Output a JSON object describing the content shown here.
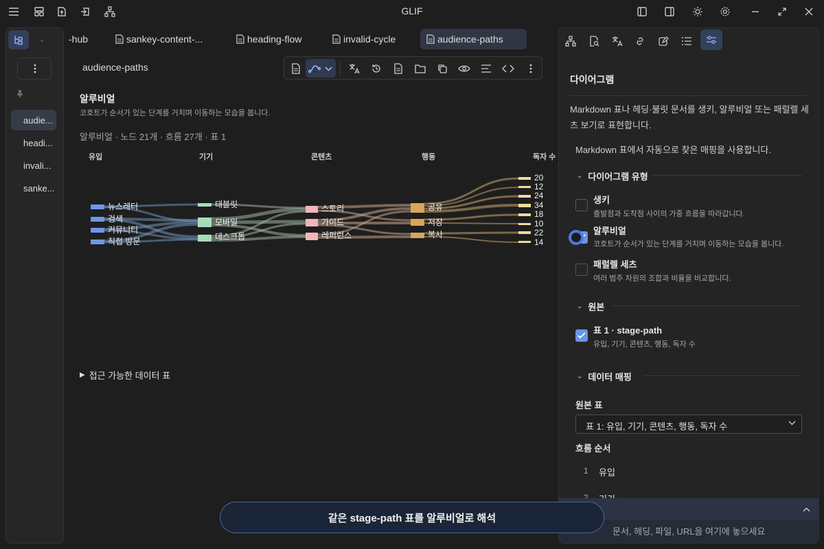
{
  "app": {
    "title": "GLIF"
  },
  "left_sidebar": {
    "files": [
      "audie...",
      "headi...",
      "invali...",
      "sanke..."
    ],
    "active_index": 0
  },
  "tabs": {
    "items": [
      {
        "label": "-hub",
        "active": false
      },
      {
        "label": "sankey-content-...",
        "active": false
      },
      {
        "label": "heading-flow",
        "active": false
      },
      {
        "label": "invalid-cycle",
        "active": false
      },
      {
        "label": "audience-paths",
        "active": true
      }
    ]
  },
  "document": {
    "name": "audience-paths",
    "heading": "알루비얼",
    "description": "코호트가 순서가 있는 단계를 거치며 이동하는 모습을 봅니다.",
    "stats": "알루비얼 · 노드 21개 · 흐름 27개 · 표 1",
    "accessible_table": "접근 가능한 데이터 표"
  },
  "alluvial": {
    "stages": [
      "유입",
      "기기",
      "콘텐츠",
      "행동",
      "독자 수"
    ],
    "nodes": {
      "source": [
        "뉴스레터",
        "검색",
        "커뮤니티",
        "직접 방문"
      ],
      "device": [
        "태블릿",
        "모바일",
        "데스크톱"
      ],
      "content": [
        "스토리",
        "가이드",
        "레퍼런스"
      ],
      "action": [
        "공유",
        "저장",
        "복사"
      ],
      "reader_counts": [
        "20",
        "12",
        "24",
        "34",
        "18",
        "10",
        "22",
        "14"
      ]
    },
    "colors": {
      "source": "#6e97e8",
      "device": "#a8dcb8",
      "content": "#f0b6b8",
      "action": "#d9a55a",
      "reader": "#f0dca0"
    }
  },
  "right_panel": {
    "title": "다이어그램",
    "intro": "Markdown 표나 헤딩·불릿 문서를 생키, 알루비얼 또는 패럴렐 세츠 보기로 표현합니다.",
    "auto_note": "Markdown 표에서 자동으로 찾은 매핑을 사용합니다.",
    "diagram_type": {
      "heading": "다이어그램 유형",
      "options": [
        {
          "title": "생키",
          "desc": "출발점과 도착점 사이의 가중 흐름을 따라갑니다.",
          "checked": false
        },
        {
          "title": "알루비얼",
          "desc": "코호트가 순서가 있는 단계를 거치며 이동하는 모습을 봅니다.",
          "checked": true
        },
        {
          "title": "패럴렐 세츠",
          "desc": "여러 범주 차원의 조합과 비율을 비교합니다.",
          "checked": false
        }
      ]
    },
    "source": {
      "heading": "원본",
      "table_title": "표 1 · stage-path",
      "table_desc": "유입, 기기, 콘텐츠, 행동, 독자 수"
    },
    "mapping": {
      "heading": "데이터 매핑",
      "source_table_label": "원본 표",
      "source_table_value": "표 1: 유입, 기기, 콘텐츠, 행동, 독자 수",
      "flow_order_label": "흐름 순서",
      "flow_items": [
        {
          "num": "1",
          "label": "유입"
        },
        {
          "num": "2",
          "label": "기기"
        }
      ]
    },
    "dropzone_placeholder": "문서, 헤딩, 파일, URL을 여기에 놓으세요"
  },
  "cta": {
    "label": "같은 stage-path 표를 알루비얼로 해석"
  }
}
